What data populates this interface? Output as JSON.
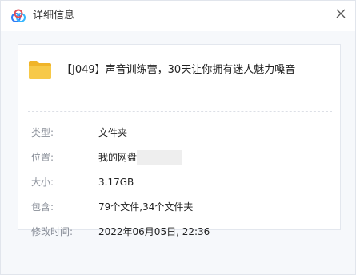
{
  "window": {
    "title": "详细信息",
    "icon": "baidu-netdisk-cloud-icon",
    "close_icon": "close-icon"
  },
  "file": {
    "icon": "folder-icon",
    "name": "【J049】声音训练营，30天让你拥有迷人魅力嗓音"
  },
  "details": [
    {
      "label": "类型:",
      "value": "文件夹"
    },
    {
      "label": "位置:",
      "value": "我的网盘"
    },
    {
      "label": "大小:",
      "value": "3.17GB"
    },
    {
      "label": "包含:",
      "value": "79个文件,34个文件夹"
    },
    {
      "label": "修改时间:",
      "value": "2022年06月05日, 22:36"
    }
  ],
  "colors": {
    "accent": "#2e7bf6",
    "folder": "#f7c948",
    "label_text": "#8a8f99",
    "value_text": "#222222"
  }
}
